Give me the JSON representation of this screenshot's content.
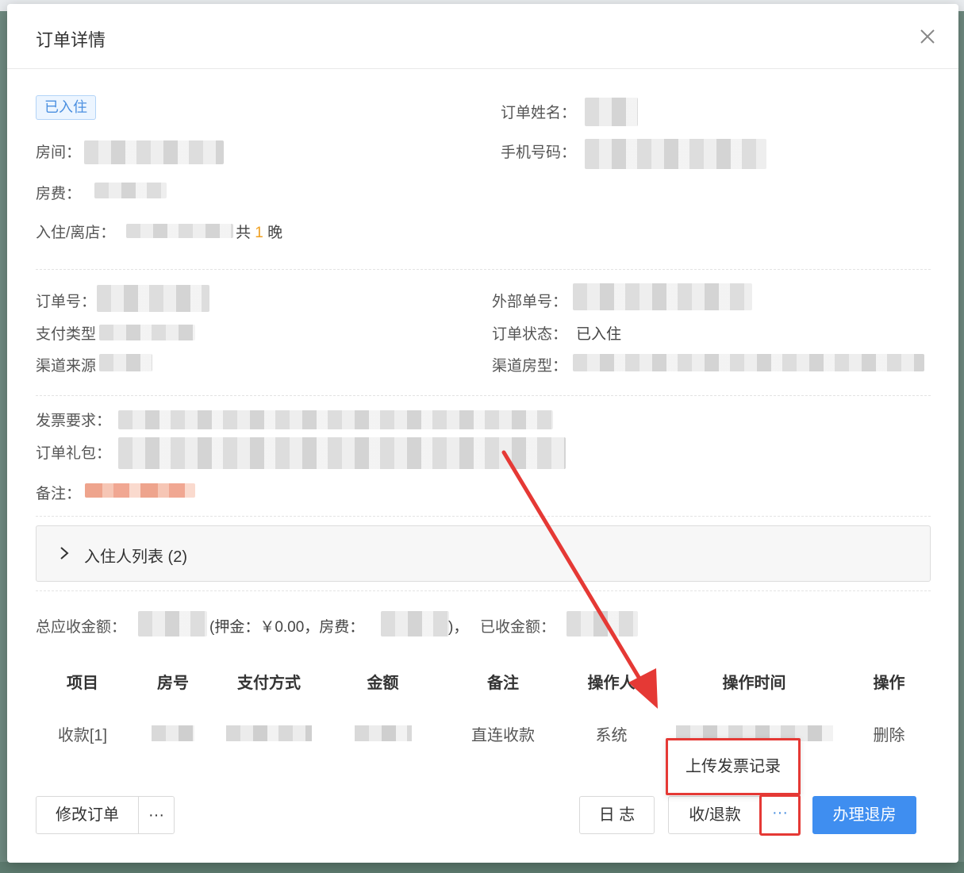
{
  "modal": {
    "title": "订单详情",
    "status_tag": "已入住"
  },
  "info": {
    "order_name_label": "订单姓名：",
    "room_label": "房间：",
    "phone_label": "手机号码：",
    "fee_label": "房费：",
    "checkin_label": "入住/离店：",
    "nights_prefix": "共",
    "nights_count": "1",
    "nights_suffix": "晚",
    "order_no_label": "订单号：",
    "external_no_label": "外部单号：",
    "pay_type_label": "支付类型",
    "order_status_label": "订单状态：",
    "order_status_value": "已入住",
    "channel_source_label": "渠道来源",
    "channel_room_label": "渠道房型：",
    "invoice_label": "发票要求：",
    "gift_label": "订单礼包：",
    "remark_label": "备注："
  },
  "guests": {
    "label": "入住人列表 (2)"
  },
  "summary": {
    "total_label": "总应收金额：",
    "detail_open": "(押金：￥0.00，房费：",
    "detail_close": ")，",
    "received_label": "已收金额："
  },
  "table": {
    "headers": [
      "项目",
      "房号",
      "支付方式",
      "金额",
      "备注",
      "操作人",
      "操作时间",
      "操作"
    ],
    "rows": [
      {
        "item": "收款[1]",
        "remark": "直连收款",
        "operator": "系统",
        "action": "删除"
      }
    ]
  },
  "popup": {
    "upload_invoice": "上传发票记录"
  },
  "footer": {
    "edit_order": "修改订单",
    "more": "···",
    "log": "日 志",
    "collect_refund": "收/退款",
    "more_dots": "···",
    "checkout": "办理退房"
  },
  "colors": {
    "primary": "#3f8ef0",
    "highlight": "#e53935",
    "tag_text": "#4a8fe0",
    "nights_highlight": "#f0a020"
  }
}
